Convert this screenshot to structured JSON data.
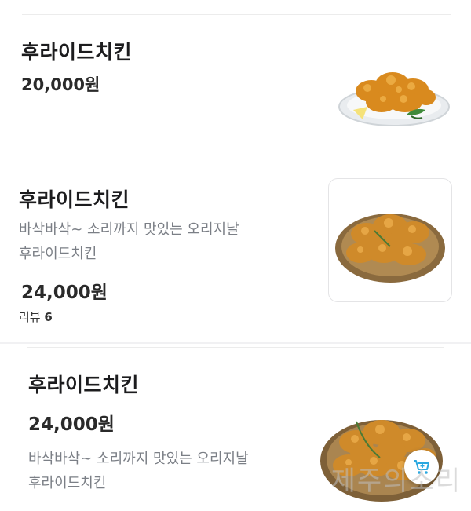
{
  "items": [
    {
      "name": "후라이드치킨",
      "price": "20,000원"
    },
    {
      "name": "후라이드치킨",
      "description_line1": "바삭바삭~ 소리까지 맛있는 오리지날",
      "description_line2": "후라이드치킨",
      "price": "24,000원",
      "review_label": "리뷰",
      "review_count": "6"
    },
    {
      "name": "후라이드치킨",
      "price": "24,000원",
      "description_line1": "바삭바삭~ 소리까지 맛있는 오리지날",
      "description_line2": "후라이드치킨"
    }
  ],
  "colors": {
    "text_primary": "#1c1c1e",
    "text_secondary": "#7b7f86",
    "cart_accent": "#2ba8e0"
  },
  "icons": {
    "cart": "shopping-cart-icon"
  },
  "watermark": "제주의소리"
}
